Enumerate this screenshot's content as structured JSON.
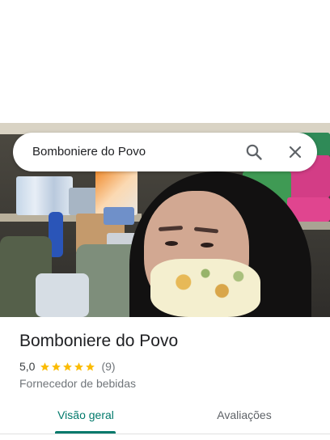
{
  "search": {
    "query": "Bomboniere do Povo"
  },
  "place": {
    "name": "Bomboniere do Povo",
    "rating": "5,0",
    "stars": 5,
    "review_count": "(9)",
    "category": "Fornecedor de bebidas"
  },
  "tabs": [
    {
      "label": "Visão geral",
      "active": true
    },
    {
      "label": "Avaliações",
      "active": false
    }
  ],
  "colors": {
    "accent": "#00796b",
    "star": "#fbbc04",
    "text": "#202124",
    "secondary": "#70757a"
  },
  "icons": {
    "search": "search-icon",
    "close": "close-icon",
    "star": "star-icon"
  }
}
